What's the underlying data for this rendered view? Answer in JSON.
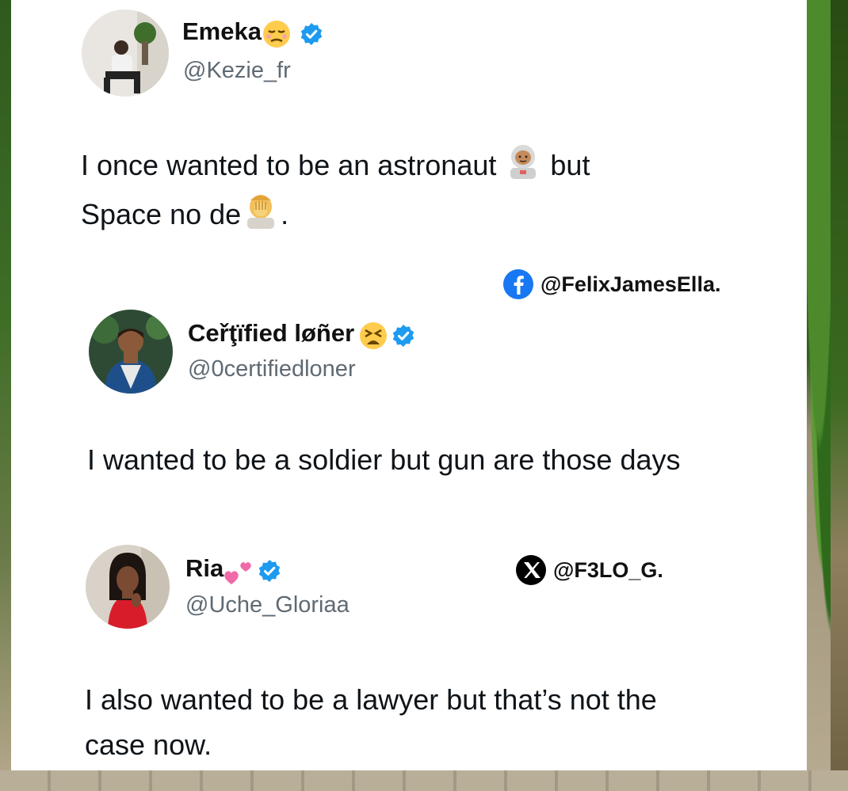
{
  "tweets": [
    {
      "name": "Emeka",
      "handle": "@Kezie_fr",
      "text_line1": "I once wanted to be an astronaut",
      "text_line1_tail": "but",
      "text_line2": "Space no de",
      "text_line2_tail": "."
    },
    {
      "name": "Ceřţïfied løñer",
      "handle": "@0certifiedloner",
      "text": "I wanted to be a soldier but gun are those days"
    },
    {
      "name": "Ria",
      "handle": "@Uche_Gloriaa",
      "text_line1": "I also wanted to be a lawyer but that’s not the",
      "text_line2": "case now."
    }
  ],
  "watermarks": {
    "facebook": "@FelixJamesElla.",
    "x": "@F3LO_G."
  },
  "icons": {
    "verified": "verified-badge-icon",
    "facebook": "facebook-logo-icon",
    "x": "x-logo-icon"
  },
  "colors": {
    "verified_blue": "#1d9bf0",
    "facebook_blue": "#1877f2",
    "handle_gray": "#5f6a73"
  }
}
